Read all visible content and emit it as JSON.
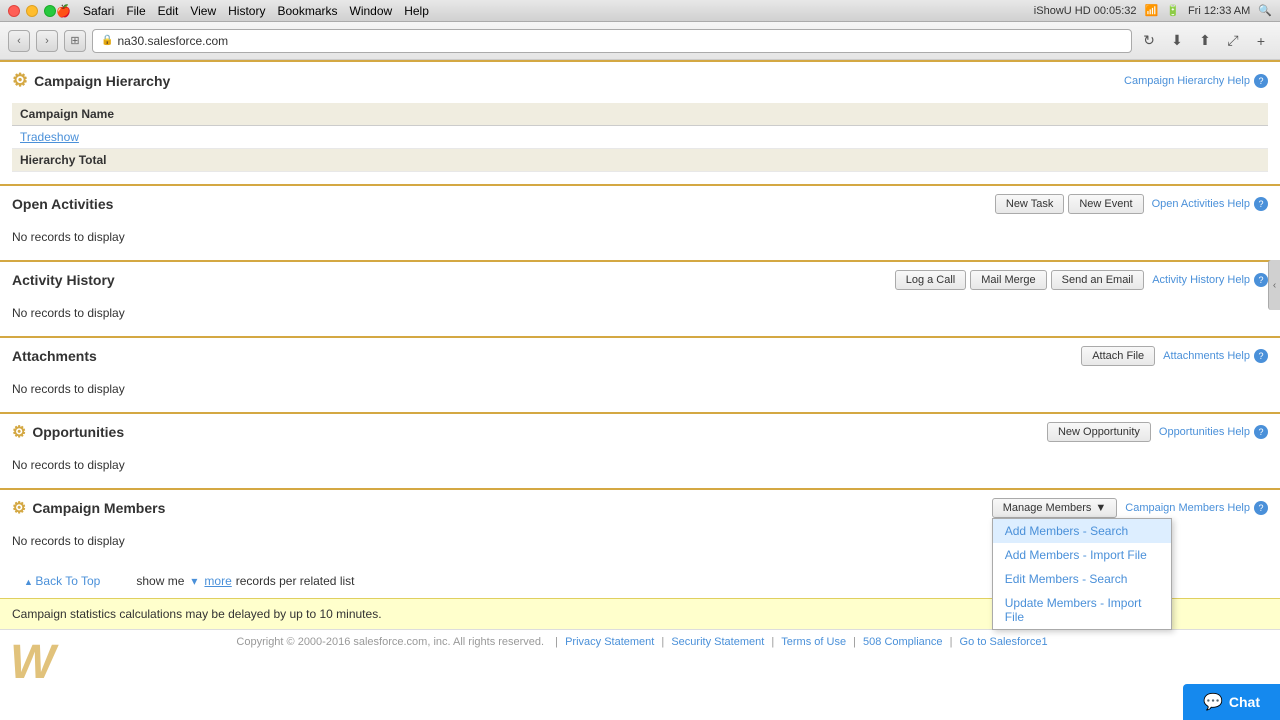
{
  "titleBar": {
    "menus": [
      "Safari",
      "File",
      "Edit",
      "View",
      "History",
      "Bookmarks",
      "Window",
      "Help"
    ],
    "time": "Fri 12:33 AM",
    "recording": "iShowU HD 00:05:32"
  },
  "browser": {
    "url": "na30.salesforce.com",
    "tabIcon": "🔒"
  },
  "campaignHierarchy": {
    "title": "Campaign Hierarchy",
    "helpLink": "Campaign Hierarchy Help",
    "columns": {
      "campaignName": "Campaign Name"
    },
    "rows": [
      {
        "name": "Tradeshow",
        "isLink": true
      }
    ],
    "totalRow": "Hierarchy Total"
  },
  "openActivities": {
    "title": "Open Activities",
    "helpLink": "Open Activities Help",
    "buttons": [
      {
        "label": "New Task",
        "name": "new-task-button"
      },
      {
        "label": "New Event",
        "name": "new-event-button"
      }
    ],
    "emptyMessage": "No records to display"
  },
  "activityHistory": {
    "title": "Activity History",
    "helpLink": "Activity History Help",
    "buttons": [
      {
        "label": "Log a Call",
        "name": "log-call-button"
      },
      {
        "label": "Mail Merge",
        "name": "mail-merge-button"
      },
      {
        "label": "Send an Email",
        "name": "send-email-button"
      }
    ],
    "emptyMessage": "No records to display"
  },
  "attachments": {
    "title": "Attachments",
    "helpLink": "Attachments Help",
    "buttons": [
      {
        "label": "Attach File",
        "name": "attach-file-button"
      }
    ],
    "emptyMessage": "No records to display"
  },
  "opportunities": {
    "title": "Opportunities",
    "helpLink": "Opportunities Help",
    "buttons": [
      {
        "label": "New Opportunity",
        "name": "new-opportunity-button"
      }
    ],
    "emptyMessage": "No records to display"
  },
  "campaignMembers": {
    "title": "Campaign Members",
    "helpLink": "Campaign Members Help",
    "manageLabel": "Manage Members",
    "dropdownItems": [
      {
        "label": "Add Members - Search",
        "name": "add-members-search",
        "active": true
      },
      {
        "label": "Add Members - Import File",
        "name": "add-members-import"
      },
      {
        "label": "Edit Members - Search",
        "name": "edit-members-search"
      },
      {
        "label": "Update Members - Import File",
        "name": "update-members-import"
      }
    ],
    "emptyMessage": "No records to display"
  },
  "moreRecords": {
    "text": "show me",
    "moreText": "more",
    "suffix": "records per related list"
  },
  "backToTop": "Back To Top",
  "warningBanner": "Campaign statistics calculations may be delayed by up to 10 minutes.",
  "footer": {
    "copyright": "Copyright © 2000-2016 salesforce.com, inc. All rights reserved.",
    "links": [
      {
        "label": "Privacy Statement"
      },
      {
        "label": "Security Statement"
      },
      {
        "label": "Terms of Use"
      },
      {
        "label": "508 Compliance"
      },
      {
        "label": "Go to Salesforce1"
      }
    ]
  },
  "chat": {
    "label": "Chat"
  }
}
